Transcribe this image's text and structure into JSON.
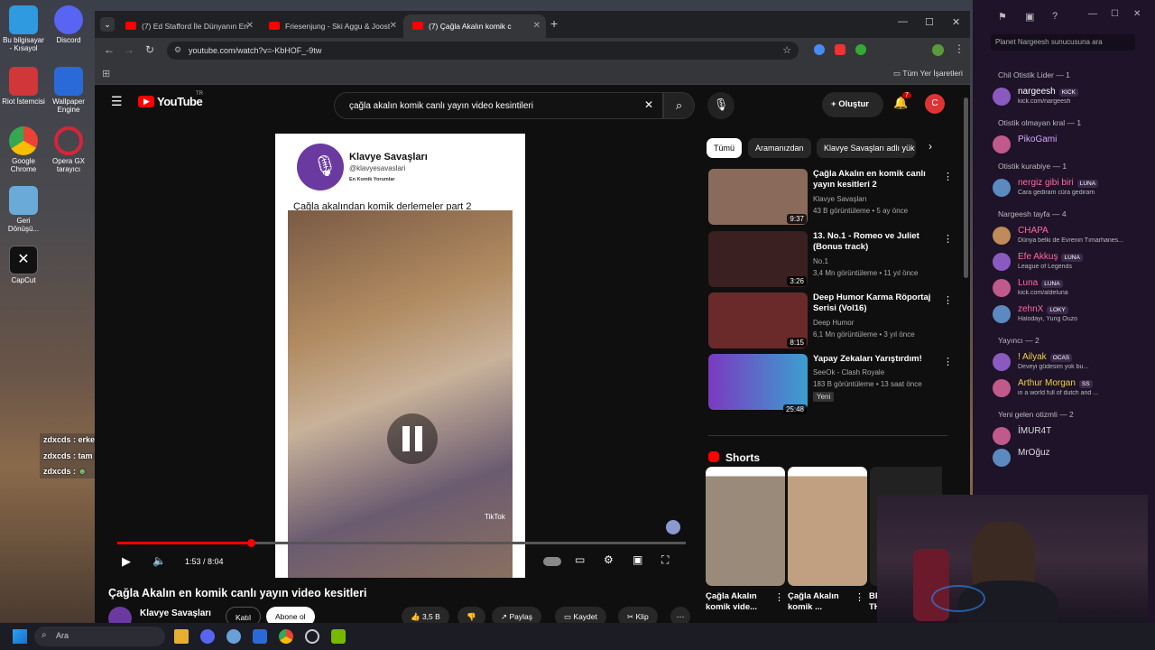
{
  "desktop": {
    "icons": [
      {
        "label": "Bu bilgisayar - Kısayol",
        "color": "#2f9ae0"
      },
      {
        "label": "Discord",
        "color": "#5865f2"
      },
      {
        "label": "Riot İstemcisi",
        "color": "#d13639"
      },
      {
        "label": "Wallpaper Engine",
        "color": "#2a6ad8"
      },
      {
        "label": "Google Chrome",
        "color": "#34a853"
      },
      {
        "label": "Opera GX tarayıcı",
        "color": "#d8243a"
      },
      {
        "label": "Geri Dönüşü...",
        "color": "#6aaad8"
      },
      {
        "label": "CapCut",
        "color": "#111"
      }
    ]
  },
  "browser": {
    "tabs": [
      {
        "title": "(7) Ed Stafford İle Dünyanın En"
      },
      {
        "title": "Friesenjung - Ski Aggu & Joost"
      },
      {
        "title": "(7) Çağla Akalın komik c"
      }
    ],
    "url": "youtube.com/watch?v=-KbHOF_-9tw",
    "bookmarks_label": "Tüm Yer İşaretleri"
  },
  "youtube": {
    "logo": "YouTube",
    "logo_region": "TR",
    "search_value": "çağla akalın komik canlı yayın video kesintileri",
    "create_label": "Oluştur",
    "notif_count": "7",
    "avatar_letter": "C",
    "video": {
      "channel_card_name": "Klavye Savaşları",
      "channel_card_handle": "@klavyesavaslari",
      "channel_card_tag": "En Komik Yorumlar",
      "overlay_caption": "Çağla akalından komik derlemeler part 2",
      "watermark": "TikTok",
      "time": "1:53 / 8:04",
      "progress": 0.235
    },
    "title": "Çağla Akalın en komik canlı yayın video kesitleri",
    "channel": "Klavye Savaşları",
    "join_label": "Katıl",
    "subscribe_label": "Abone ol",
    "likes": "3,5 B",
    "share_label": "Paylaş",
    "save_label": "Kaydet",
    "clip_label": "Klip",
    "chips": [
      "Tümü",
      "Aramanızdan",
      "Klavye Savaşları adlı yük"
    ],
    "recommendations": [
      {
        "title": "Çağla Akalın en komik canlı yayın kesitleri 2",
        "channel": "Klavye Savaşları",
        "meta": "43 B görüntüleme • 5 ay önce",
        "duration": "9:37",
        "color": "#8a6a5a"
      },
      {
        "title": "13. No.1 - Romeo ve Juliet (Bonus track)",
        "channel": "No.1",
        "meta": "3,4 Mn görüntüleme • 11 yıl önce",
        "duration": "3:26",
        "color": "#3a2020"
      },
      {
        "title": "Deep Humor Karma Röportaj Serisi (Vol16)",
        "channel": "Deep Humor",
        "meta": "6,1 Mn görüntüleme • 3 yıl önce",
        "duration": "8:15",
        "color": "#6a2a2a"
      },
      {
        "title": "Yapay Zekaları Yarıştırdım!",
        "channel": "SeeOk - Clash Royale",
        "meta": "183 B görüntüleme • 13 saat önce",
        "duration": "25:48",
        "badge": "Yeni",
        "color": "#4a8a3a"
      }
    ],
    "shorts_label": "Shorts",
    "shorts": [
      {
        "title": "Çağla Akalın komik vide..."
      },
      {
        "title": "Çağla Akalın komik ..."
      },
      {
        "title": "BR TH"
      }
    ]
  },
  "chat": [
    {
      "user": "zdxcds",
      "message": "erkek"
    },
    {
      "user": "zdxcds",
      "message": "tam yeter"
    },
    {
      "user": "zdxcds",
      "message": ""
    }
  ],
  "discord": {
    "search_placeholder": "Planet Nargeesh sunucusuna ara",
    "groups": [
      {
        "label": "Chil Otistik Lider — 1",
        "members": [
          {
            "name": "nargeesh",
            "badge": "KICK",
            "status": "kick.com/nargeesh",
            "color": "#fff"
          }
        ]
      },
      {
        "label": "Otistik olmayan kral — 1",
        "members": [
          {
            "name": "PikoGami",
            "badge": "",
            "status": "",
            "color": "#d8a8ff"
          }
        ]
      },
      {
        "label": "Otistik kurabiye — 1",
        "members": [
          {
            "name": "nergiz gibi biri",
            "badge": "LUNA",
            "status": "Cara gediram cüra gediram",
            "color": "#ff6aa0"
          }
        ]
      },
      {
        "label": "Nargeesh tayfa — 4",
        "members": [
          {
            "name": "CHAPA",
            "badge": "",
            "status": "Dünya belki de Evrenin Tımarhanes...",
            "color": "#ff6aa0"
          },
          {
            "name": "Efe Akkuş",
            "badge": "LUNA",
            "status": "League of Legends",
            "color": "#ff6aa0"
          },
          {
            "name": "Luna",
            "badge": "LUNA",
            "status": "kick.com/aldeluna",
            "color": "#ff6aa0"
          },
          {
            "name": "zehnX",
            "badge": "LOKY",
            "status": "Halodayı, Yung Ouzo",
            "color": "#ff6aa0"
          }
        ]
      },
      {
        "label": "Yayıncı — 2",
        "members": [
          {
            "name": "! Ailyak",
            "badge": "OCAS",
            "status": "Deveyi güdesim yok bu...",
            "color": "#f0d040"
          },
          {
            "name": "Arthur Morgan",
            "badge": "SS",
            "status": "in a world full of dutch and ...",
            "color": "#f0d040"
          }
        ]
      },
      {
        "label": "Yeni gelen otizmli — 2",
        "members": [
          {
            "name": "İMUR4T",
            "badge": "",
            "status": "",
            "color": "#ddd"
          },
          {
            "name": "MrOğuz",
            "badge": "",
            "status": "",
            "color": "#ddd"
          }
        ]
      }
    ]
  },
  "taskbar": {
    "search_placeholder": "Ara"
  },
  "colors": {
    "yt_red": "#ff0000",
    "discord_bg": "#1e1329"
  }
}
